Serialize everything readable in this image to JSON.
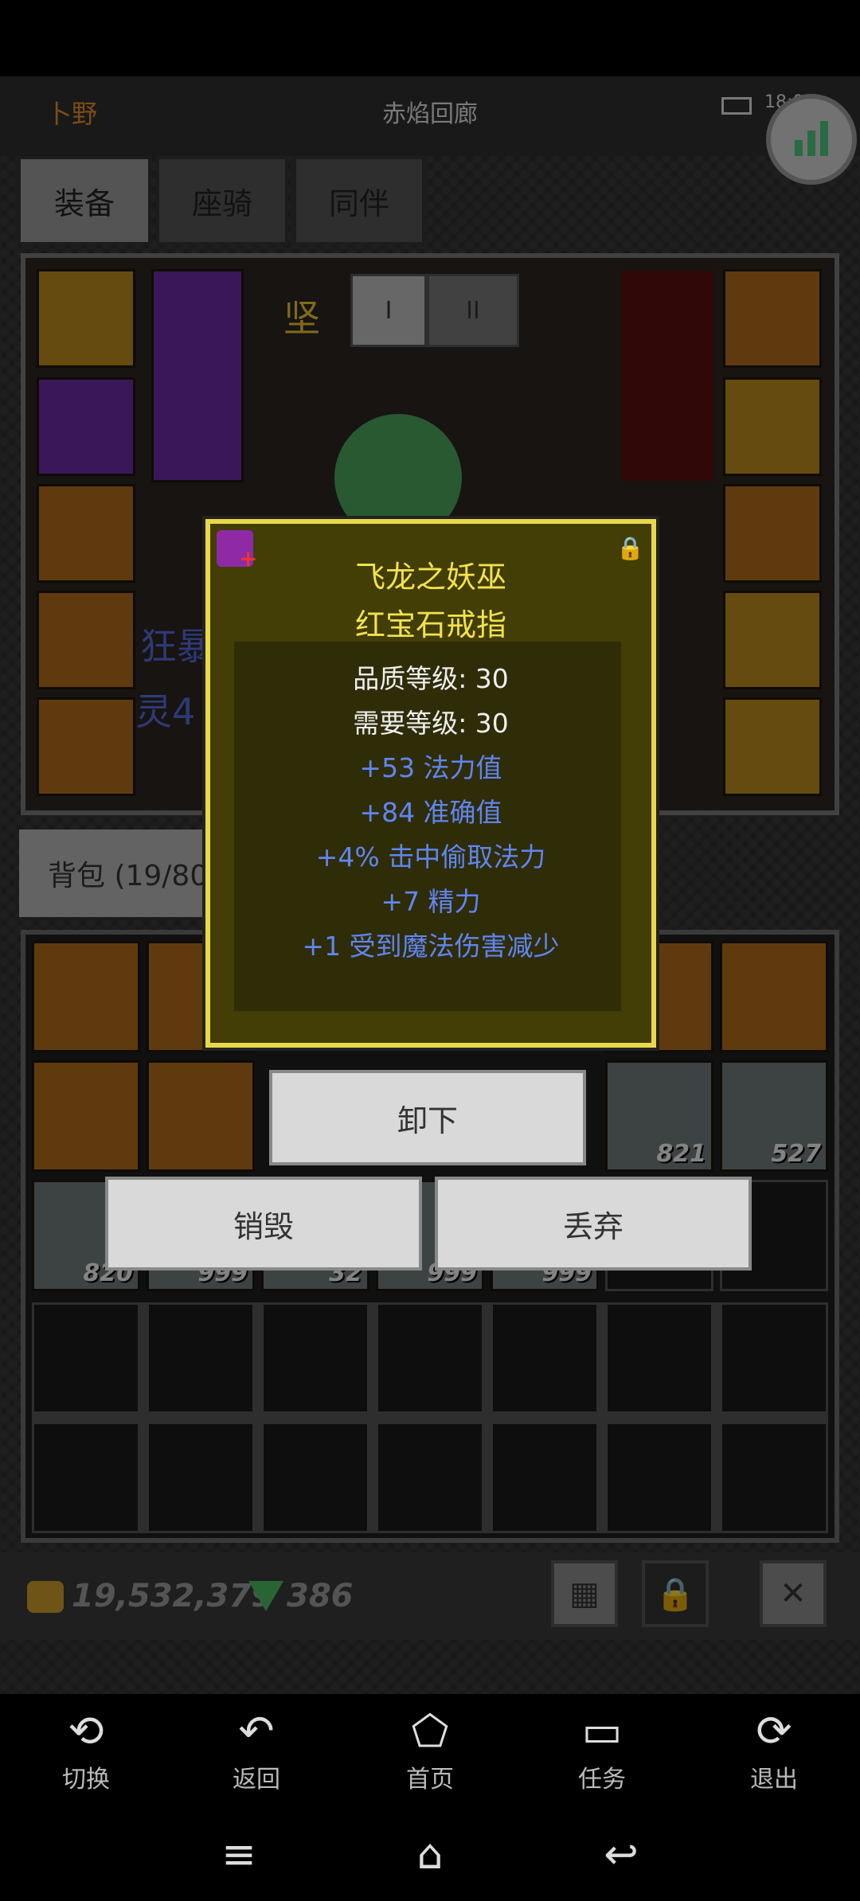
{
  "status": {
    "time": "18:07"
  },
  "header": {
    "player": "卜野",
    "location": "赤焰回廊"
  },
  "tabs": [
    {
      "label": "装备"
    },
    {
      "label": "座骑"
    },
    {
      "label": "同伴"
    }
  ],
  "equip_view": {
    "top_tabs": [
      "I",
      "II"
    ],
    "side_text_1": "狂暴",
    "side_text_2": "灵4",
    "name_partial": "坚"
  },
  "bag": {
    "label": "背包 (19/80"
  },
  "bag_counts": {
    "fish": "821",
    "scroll": "527",
    "potion": "820",
    "c2": "999",
    "c3": "32",
    "c4": "999",
    "c5": "999"
  },
  "currency": {
    "gold": "19,532,379",
    "gems": "386"
  },
  "item": {
    "name": "飞龙之妖巫",
    "type": "红宝石戒指",
    "quality": "品质等级: 30",
    "required": "需要等级: 30",
    "stats": [
      "+53 法力值",
      "+84 准确值",
      "+4% 击中偷取法力",
      "+7 精力",
      "+1 受到魔法伤害减少"
    ]
  },
  "actions": {
    "unequip": "卸下",
    "destroy": "销毁",
    "discard": "丢弃"
  },
  "nav": [
    {
      "label": "切换"
    },
    {
      "label": "返回"
    },
    {
      "label": "首页"
    },
    {
      "label": "任务"
    },
    {
      "label": "退出"
    }
  ]
}
